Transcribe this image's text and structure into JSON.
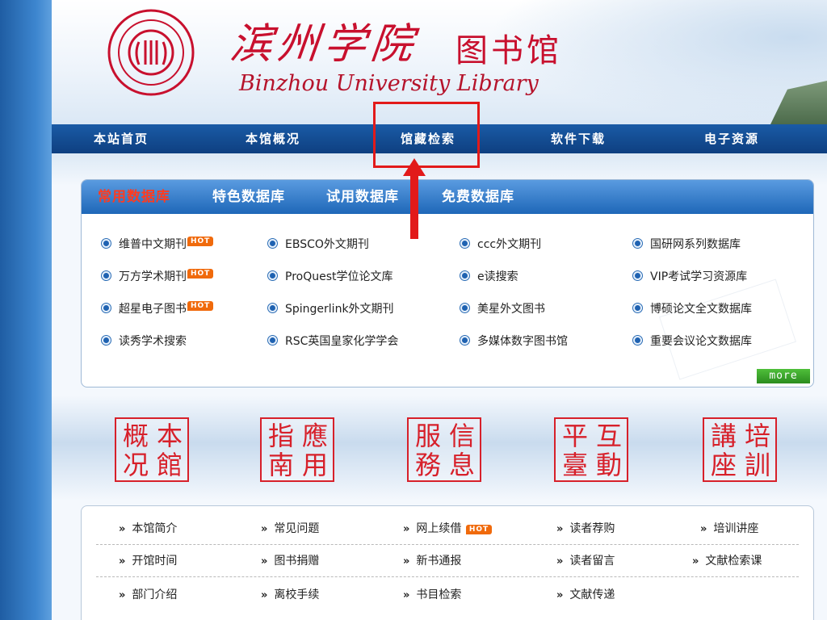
{
  "header": {
    "brand_cn": "滨州学院",
    "brand_lib": "图书馆",
    "brand_en": "Binzhou University Library",
    "logo_alt": "BINZHOU UNIVERSITY"
  },
  "nav": {
    "items": [
      {
        "label": "本站首页"
      },
      {
        "label": "本馆概况"
      },
      {
        "label": "馆藏检索"
      },
      {
        "label": "软件下载"
      },
      {
        "label": "电子资源"
      }
    ]
  },
  "db": {
    "tabs": [
      {
        "label": "常用数据库",
        "active": true
      },
      {
        "label": "特色数据库"
      },
      {
        "label": "试用数据库"
      },
      {
        "label": "免费数据库"
      }
    ],
    "columns": [
      [
        {
          "label": "维普中文期刊",
          "hot": "HOT"
        },
        {
          "label": "万方学术期刊",
          "hot": "HOT"
        },
        {
          "label": "超星电子图书",
          "hot": "HOT"
        },
        {
          "label": "读秀学术搜索"
        }
      ],
      [
        {
          "label": "EBSCO外文期刊"
        },
        {
          "label": "ProQuest学位论文库"
        },
        {
          "label": "Spingerlink外文期刊"
        },
        {
          "label": "RSC英国皇家化学学会"
        }
      ],
      [
        {
          "label": "ccc外文期刊"
        },
        {
          "label": "e读搜索"
        },
        {
          "label": "美星外文图书"
        },
        {
          "label": "多媒体数字图书馆"
        }
      ],
      [
        {
          "label": "国研网系列数据库"
        },
        {
          "label": "VIP考试学习资源库"
        },
        {
          "label": "博硕论文全文数据库"
        },
        {
          "label": "重要会议论文数据库"
        }
      ]
    ],
    "more_label": "more"
  },
  "stamps": [
    {
      "a": "本",
      "b": "概",
      "c": "館",
      "d": "况"
    },
    {
      "a": "應",
      "b": "指",
      "c": "用",
      "d": "南"
    },
    {
      "a": "信",
      "b": "服",
      "c": "息",
      "d": "務"
    },
    {
      "a": "互",
      "b": "平",
      "c": "動",
      "d": "臺"
    },
    {
      "a": "培",
      "b": "講",
      "c": "訓",
      "d": "座"
    }
  ],
  "links": {
    "chevron": "»",
    "rows": [
      [
        {
          "label": "本馆简介"
        },
        {
          "label": "常见问题"
        },
        {
          "label": "网上续借",
          "hot": "HOT"
        },
        {
          "label": "读者荐购"
        },
        {
          "label": "培训讲座"
        }
      ],
      [
        {
          "label": "开馆时间"
        },
        {
          "label": "图书捐赠"
        },
        {
          "label": "新书通报"
        },
        {
          "label": "读者留言"
        },
        {
          "label": "文献检索课"
        }
      ],
      [
        {
          "label": "部门介绍"
        },
        {
          "label": "离校手续"
        },
        {
          "label": "书目检索"
        },
        {
          "label": "文献传递"
        }
      ]
    ]
  },
  "colors": {
    "brand_red": "#c8102e",
    "nav_blue": "#0e3f80",
    "highlight": "#e21a1a"
  }
}
